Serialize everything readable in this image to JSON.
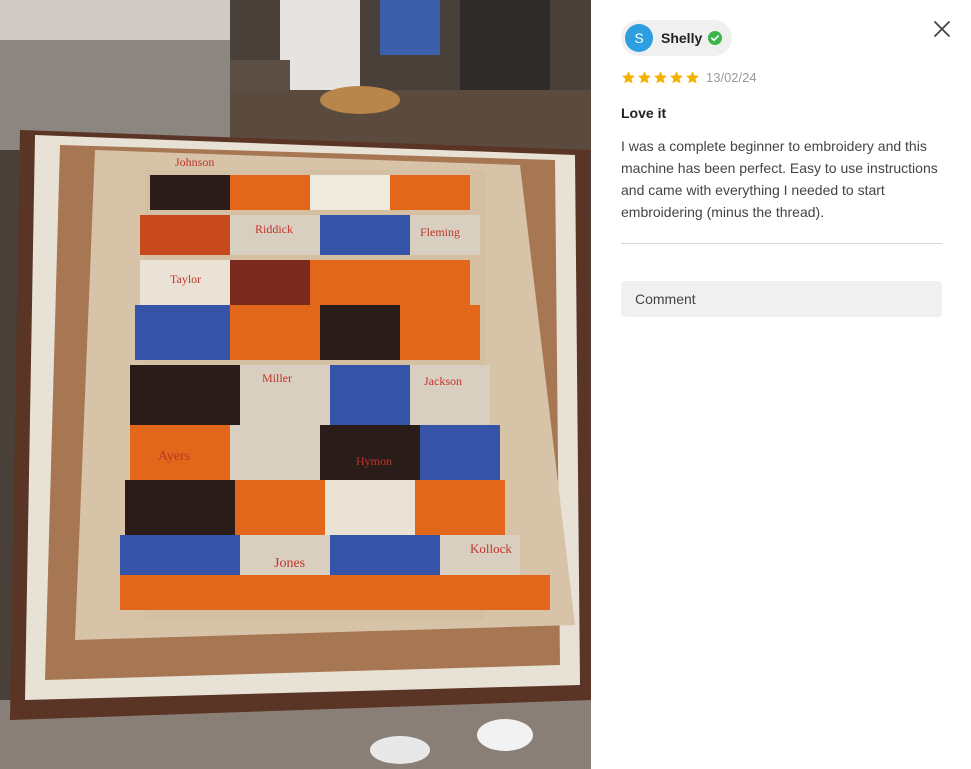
{
  "photo": {
    "quilt_names": [
      "Johnson",
      "Riddick",
      "Fleming",
      "Taylor",
      "Miller",
      "Jackson",
      "Ayers",
      "Hymon",
      "Jones",
      "Kollock"
    ]
  },
  "review": {
    "author": {
      "initial": "S",
      "name": "Shelly",
      "verified": true
    },
    "rating": 5,
    "date": "13/02/24",
    "title": "Love it",
    "body": "I was a complete beginner to embroidery and this machine has been perfect. Easy to use instructions and came with everything I needed to start embroidering (minus the thread)."
  },
  "comment": {
    "label": "Comment"
  },
  "colors": {
    "avatar": "#2d9ee0",
    "star": "#f5b301",
    "verified": "#3bb54a"
  },
  "icons": [
    "close-icon",
    "star-icon",
    "verified-check-icon"
  ]
}
